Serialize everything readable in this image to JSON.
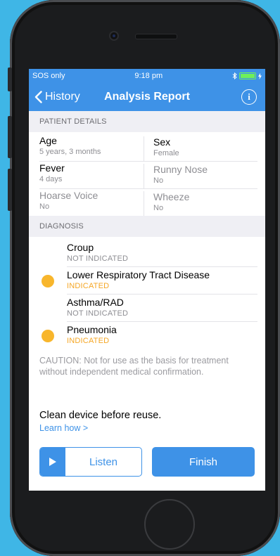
{
  "status_bar": {
    "carrier": "SOS only",
    "time": "9:18 pm"
  },
  "nav": {
    "back_label": "History",
    "title": "Analysis Report",
    "info_icon": "info-icon"
  },
  "patient_details": {
    "header": "PATIENT DETAILS",
    "fields": [
      {
        "label": "Age",
        "value": "5 years, 3 months",
        "active": true
      },
      {
        "label": "Sex",
        "value": "Female",
        "active": true
      },
      {
        "label": "Fever",
        "value": "4 days",
        "active": true
      },
      {
        "label": "Runny Nose",
        "value": "No",
        "active": false
      },
      {
        "label": "Hoarse Voice",
        "value": "No",
        "active": false
      },
      {
        "label": "Wheeze",
        "value": "No",
        "active": false
      }
    ]
  },
  "diagnosis": {
    "header": "DIAGNOSIS",
    "items": [
      {
        "name": "Croup",
        "status": "NOT INDICATED",
        "indicated": false
      },
      {
        "name": "Lower Respiratory Tract Disease",
        "status": "INDICATED",
        "indicated": true
      },
      {
        "name": "Asthma/RAD",
        "status": "NOT INDICATED",
        "indicated": false
      },
      {
        "name": "Pneumonia",
        "status": "INDICATED",
        "indicated": true
      }
    ]
  },
  "caution": "CAUTION: Not for use as the basis for treatment without independent medical confirmation.",
  "clean": {
    "text": "Clean device before reuse.",
    "link": "Learn how >"
  },
  "actions": {
    "listen_label": "Listen",
    "finish_label": "Finish"
  },
  "colors": {
    "accent": "#3e92e7",
    "indicated": "#f5a623",
    "background": "#3fb6e6"
  }
}
